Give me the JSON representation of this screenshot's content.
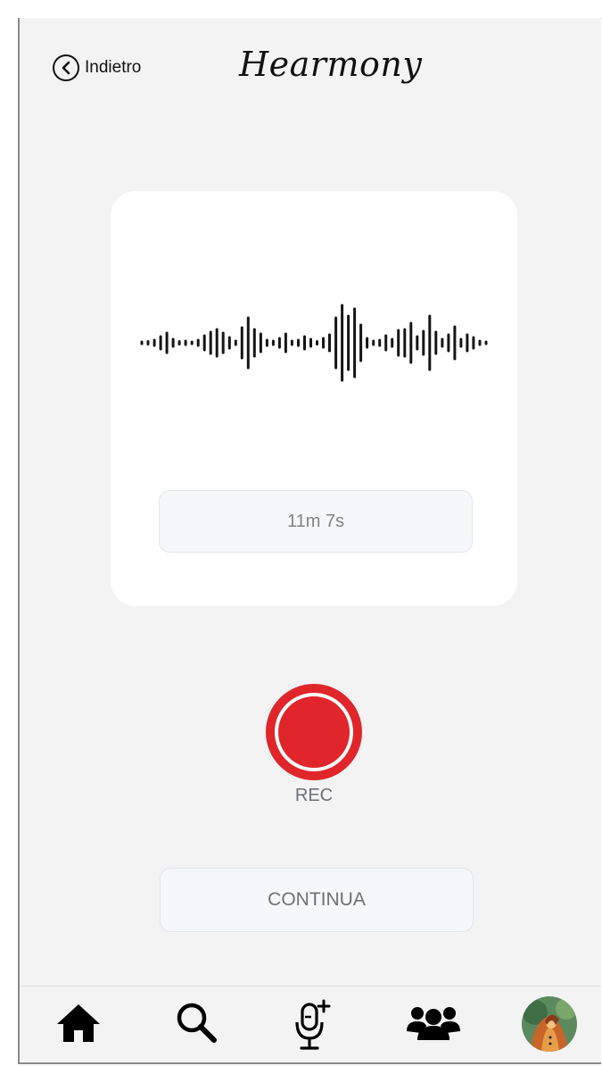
{
  "header": {
    "back_label": "Indietro",
    "app_title": "Hearmony"
  },
  "recorder": {
    "duration": "11m 7s",
    "rec_label": "REC",
    "rec_color": "#e0262a"
  },
  "actions": {
    "continue_label": "CONTINUA"
  },
  "tabbar": {
    "items": [
      {
        "name": "home",
        "icon": "home-icon"
      },
      {
        "name": "search",
        "icon": "search-icon"
      },
      {
        "name": "record",
        "icon": "mic-plus-icon"
      },
      {
        "name": "community",
        "icon": "group-icon"
      },
      {
        "name": "profile",
        "icon": "avatar"
      }
    ]
  }
}
